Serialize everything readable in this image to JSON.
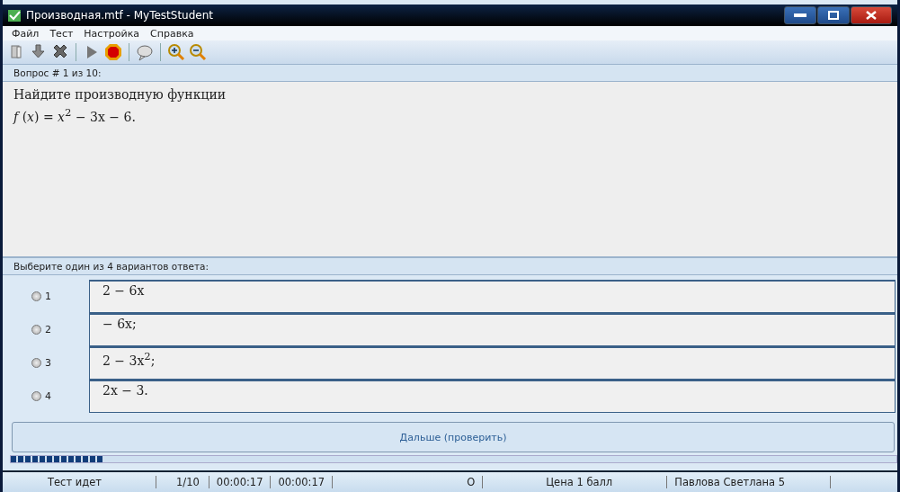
{
  "window": {
    "title": "Производная.mtf - MyTestStudent"
  },
  "menu": [
    "Файл",
    "Тест",
    "Настройка",
    "Справка"
  ],
  "question": {
    "header": "Вопрос # 1 из 10:",
    "text": "Найдите производную функции",
    "formula": "*f* (*x*) = *x*$^{2}$ − 3x − 6."
  },
  "answers_header": "Выберите один из 4 вариантов ответа:",
  "answers": [
    {
      "number": "1",
      "text": "2 − 6x",
      "selected": false
    },
    {
      "number": "2",
      "text": "− 6x;",
      "selected": false
    },
    {
      "number": "3",
      "text": "2 − 3x$^{2}$;",
      "selected": false
    },
    {
      "number": "4",
      "text": "2x − 3.",
      "selected": false
    }
  ],
  "next_button": "Дальше (проверить)",
  "progress": {
    "level": 0.105
  },
  "status_bar": [
    "Тест идет",
    "1/10",
    "00:00:17",
    "00:00:17",
    "O",
    "Цена 1 балл",
    "Павлова Светлана 5"
  ]
}
